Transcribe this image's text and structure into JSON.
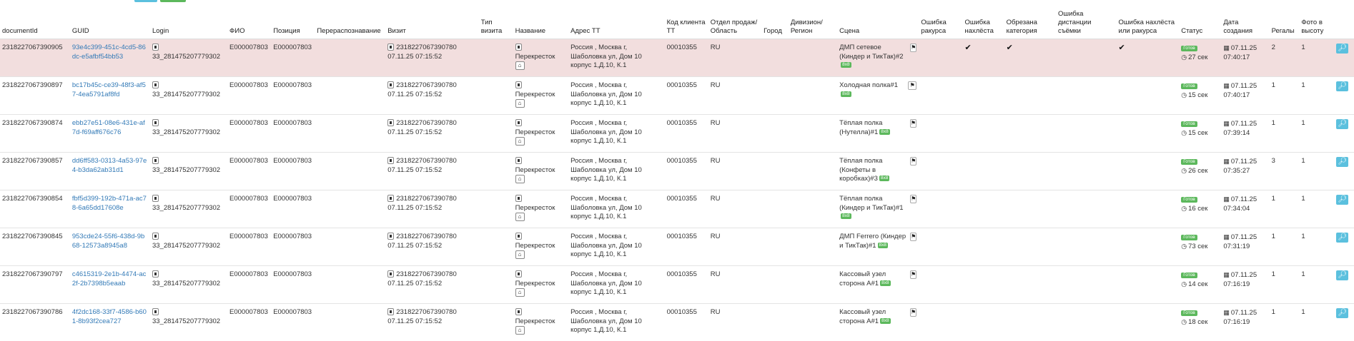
{
  "headers": {
    "documentId": "documentId",
    "guid": "GUID",
    "login": "Login",
    "fio": "ФИО",
    "position": "Позиция",
    "recognition": "Перераспознавание",
    "visit": "Визит",
    "visit_type": "Тип визита",
    "name": "Название",
    "address": "Адрес ТТ",
    "client_code": "Код клиента ТТ",
    "sales_dept": "Отдел продаж/ Область",
    "city": "Город",
    "division": "Дивизион/ Регион",
    "scene": "Сцена",
    "err_angle": "Ошибка ракурса",
    "err_overlap": "Ошибка нахлёста",
    "cut_category": "Обрезана категория",
    "err_distance": "Ошибка дистанции съёмки",
    "err_overlap_angle": "Ошибка нахлёста или ракурса",
    "status": "Статус",
    "created": "Дата создания",
    "shelves": "Регалы",
    "photo_height": "Фото в высоту"
  },
  "rows": [
    {
      "documentId": "2318227067390905",
      "guid": "93e4c399-451c-4cd5-86dc-e5afbf54bb53",
      "login": "33_281475207779302",
      "fio": "E000007803",
      "position": "E000007803",
      "visit_id": "2318227067390780",
      "visit_time": "07.11.25 07:15:52",
      "name": "Перекресток",
      "address": "Россия , Москва г, Шаболовка ул, Дом 10 корпус 1,Д.10, К.1",
      "client_code": "00010355",
      "sales_dept": "RU",
      "scene": "ДМП сетевое (Киндер и ТикТак)#2",
      "scene_badge": "8x8",
      "err_overlap": "✔",
      "cut_category": "✔",
      "err_overlap_angle": "✔",
      "status_label": "Готов",
      "status_time": "27 сек",
      "date": "07.11.25",
      "time": "07:40:17",
      "shelves": "2",
      "photo_height": "1",
      "highlight": true
    },
    {
      "documentId": "2318227067390897",
      "guid": "bc17b45c-ce39-48f3-af57-4ea5791af8fd",
      "login": "33_281475207779302",
      "fio": "E000007803",
      "position": "E000007803",
      "visit_id": "2318227067390780",
      "visit_time": "07.11.25 07:15:52",
      "name": "Перекресток",
      "address": "Россия , Москва г, Шаболовка ул, Дом 10 корпус 1,Д.10, К.1",
      "client_code": "00010355",
      "sales_dept": "RU",
      "scene": "Холодная полка#1",
      "scene_badge": "8x8",
      "err_overlap": "",
      "cut_category": "",
      "err_overlap_angle": "",
      "status_label": "Готов",
      "status_time": "15 сек",
      "date": "07.11.25",
      "time": "07:40:17",
      "shelves": "1",
      "photo_height": "1",
      "highlight": false
    },
    {
      "documentId": "2318227067390874",
      "guid": "ebb27e51-08e6-431e-af7d-f69aff676c76",
      "login": "33_281475207779302",
      "fio": "E000007803",
      "position": "E000007803",
      "visit_id": "2318227067390780",
      "visit_time": "07.11.25 07:15:52",
      "name": "Перекресток",
      "address": "Россия , Москва г, Шаболовка ул, Дом 10 корпус 1,Д.10, К.1",
      "client_code": "00010355",
      "sales_dept": "RU",
      "scene": "Тёплая полка (Нутелла)#1",
      "scene_badge": "8x8",
      "err_overlap": "",
      "cut_category": "",
      "err_overlap_angle": "",
      "status_label": "Готов",
      "status_time": "15 сек",
      "date": "07.11.25",
      "time": "07:39:14",
      "shelves": "1",
      "photo_height": "1",
      "highlight": false
    },
    {
      "documentId": "2318227067390857",
      "guid": "dd6ff583-0313-4a53-97e4-b3da62ab31d1",
      "login": "33_281475207779302",
      "fio": "E000007803",
      "position": "E000007803",
      "visit_id": "2318227067390780",
      "visit_time": "07.11.25 07:15:52",
      "name": "Перекресток",
      "address": "Россия , Москва г, Шаболовка ул, Дом 10 корпус 1,Д.10, К.1",
      "client_code": "00010355",
      "sales_dept": "RU",
      "scene": "Тёплая полка (Конфеты в коробках)#3",
      "scene_badge": "8x8",
      "err_overlap": "",
      "cut_category": "",
      "err_overlap_angle": "",
      "status_label": "Готов",
      "status_time": "26 сек",
      "date": "07.11.25",
      "time": "07:35:27",
      "shelves": "3",
      "photo_height": "1",
      "highlight": false
    },
    {
      "documentId": "2318227067390854",
      "guid": "fbf5d399-192b-471a-ac78-6a65dd17608e",
      "login": "33_281475207779302",
      "fio": "E000007803",
      "position": "E000007803",
      "visit_id": "2318227067390780",
      "visit_time": "07.11.25 07:15:52",
      "name": "Перекресток",
      "address": "Россия , Москва г, Шаболовка ул, Дом 10 корпус 1,Д.10, К.1",
      "client_code": "00010355",
      "sales_dept": "RU",
      "scene": "Тёплая полка (Киндер и ТикТак)#1",
      "scene_badge": "8x8",
      "err_overlap": "",
      "cut_category": "",
      "err_overlap_angle": "",
      "status_label": "Готов",
      "status_time": "16 сек",
      "date": "07.11.25",
      "time": "07:34:04",
      "shelves": "1",
      "photo_height": "1",
      "highlight": false
    },
    {
      "documentId": "2318227067390845",
      "guid": "953cde24-55f6-438d-9b68-12573a8945a8",
      "login": "33_281475207779302",
      "fio": "E000007803",
      "position": "E000007803",
      "visit_id": "2318227067390780",
      "visit_time": "07.11.25 07:15:52",
      "name": "Перекресток",
      "address": "Россия , Москва г, Шаболовка ул, Дом 10 корпус 1,Д.10, К.1",
      "client_code": "00010355",
      "sales_dept": "RU",
      "scene": "ДМП Ferrero (Киндер и ТикТак)#1",
      "scene_badge": "8x8",
      "err_overlap": "",
      "cut_category": "",
      "err_overlap_angle": "",
      "status_label": "Готов",
      "status_time": "73 сек",
      "date": "07.11.25",
      "time": "07:31:19",
      "shelves": "1",
      "photo_height": "1",
      "highlight": false
    },
    {
      "documentId": "2318227067390797",
      "guid": "c4615319-2e1b-4474-ac2f-2b7398b5eaab",
      "login": "33_281475207779302",
      "fio": "E000007803",
      "position": "E000007803",
      "visit_id": "2318227067390780",
      "visit_time": "07.11.25 07:15:52",
      "name": "Перекресток",
      "address": "Россия , Москва г, Шаболовка ул, Дом 10 корпус 1,Д.10, К.1",
      "client_code": "00010355",
      "sales_dept": "RU",
      "scene": "Кассовый узел сторона A#1",
      "scene_badge": "8x8",
      "err_overlap": "",
      "cut_category": "",
      "err_overlap_angle": "",
      "status_label": "Готов",
      "status_time": "14 сек",
      "date": "07.11.25",
      "time": "07:16:19",
      "shelves": "1",
      "photo_height": "1",
      "highlight": false
    },
    {
      "documentId": "2318227067390786",
      "guid": "4f2dc168-33f7-4586-b601-8b93f2cea727",
      "login": "33_281475207779302",
      "fio": "E000007803",
      "position": "E000007803",
      "visit_id": "2318227067390780",
      "visit_time": "07.11.25 07:15:52",
      "name": "Перекресток",
      "address": "Россия , Москва г, Шаболовка ул, Дом 10 корпус 1,Д.10, К.1",
      "client_code": "00010355",
      "sales_dept": "RU",
      "scene": "Кассовый узел сторона A#1",
      "scene_badge": "8x8",
      "err_overlap": "",
      "cut_category": "",
      "err_overlap_angle": "",
      "status_label": "Готов",
      "status_time": "18 сек",
      "date": "07.11.25",
      "time": "07:16:19",
      "shelves": "1",
      "photo_height": "1",
      "highlight": false
    }
  ],
  "colors": {
    "link": "#337ab7",
    "highlight_row": "#f2dede",
    "status_green": "#5cb85c",
    "search_btn": "#5bc0de"
  },
  "icons": {
    "doc": "file-icon",
    "home": "home-icon",
    "flag": "flag-icon",
    "search": "search-icon",
    "calendar": "calendar-icon",
    "clock": "clock-icon",
    "check": "check-icon"
  }
}
